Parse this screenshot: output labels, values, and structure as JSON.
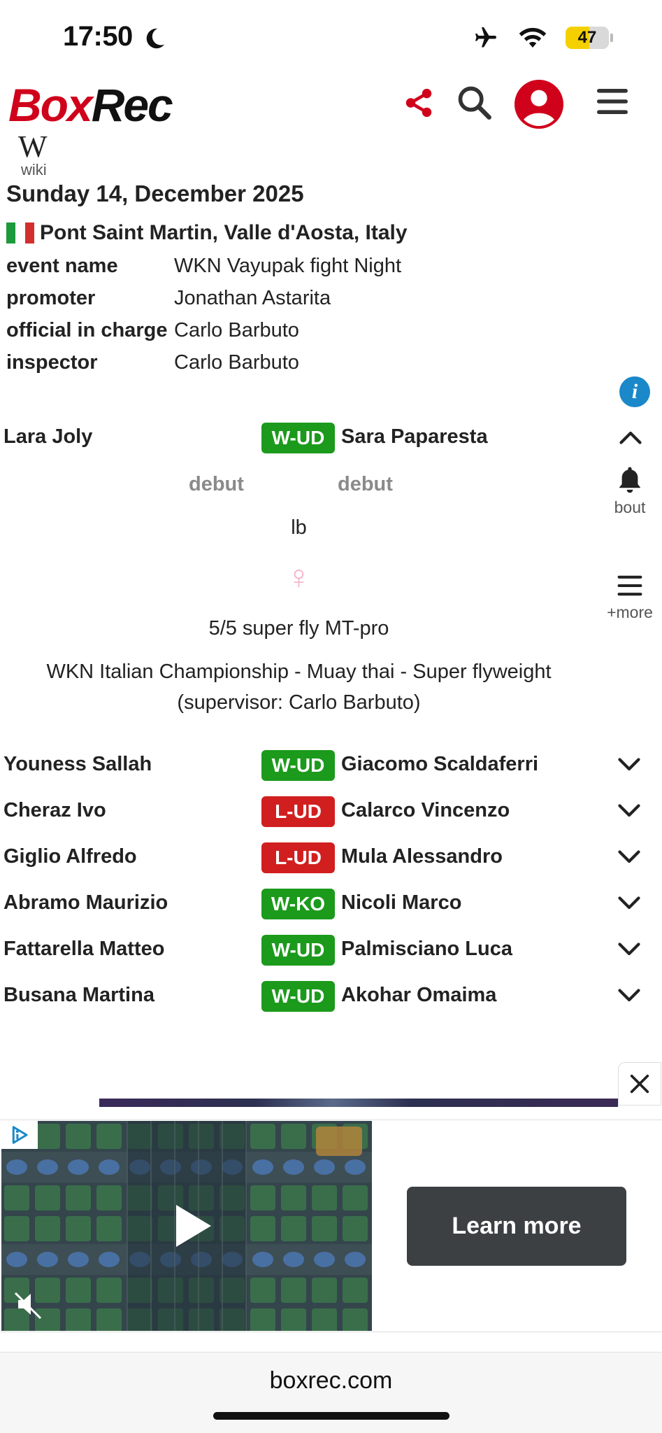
{
  "status_bar": {
    "time": "17:50",
    "battery": "47"
  },
  "header": {
    "logo_box": "Box",
    "logo_rec": "Rec",
    "wiki_symbol": "W",
    "wiki_label": "wiki"
  },
  "event": {
    "date": "Sunday 14, December 2025",
    "location": "Pont Saint Martin, Valle d'Aosta, Italy",
    "details": [
      {
        "label": "event name",
        "value": "WKN Vayupak fight Night"
      },
      {
        "label": "promoter",
        "value": "Jonathan Astarita"
      },
      {
        "label": "official in charge",
        "value": "Carlo Barbuto"
      },
      {
        "label": "inspector",
        "value": "Carlo Barbuto"
      }
    ]
  },
  "main_bout": {
    "fighter_a": "Lara Joly",
    "result": "W-UD",
    "fighter_b": "Sara Paparesta",
    "record_a": "debut",
    "record_b": "debut",
    "weight_unit": "lb",
    "gender_symbol": "♀",
    "rounds_and_class": "5/5 super fly  MT-pro",
    "title_line1": "WKN Italian Championship - Muay thai - Super flyweight",
    "title_line2": "(supervisor: Carlo Barbuto)"
  },
  "side_actions": {
    "bout_label": "bout",
    "more_label": "+more"
  },
  "bouts": [
    {
      "fighter_a": "Youness Sallah",
      "result": "W-UD",
      "outcome": "win",
      "fighter_b": "Giacomo Scaldaferri"
    },
    {
      "fighter_a": "Cheraz Ivo",
      "result": "L-UD",
      "outcome": "loss",
      "fighter_b": "Calarco Vincenzo"
    },
    {
      "fighter_a": "Giglio Alfredo",
      "result": "L-UD",
      "outcome": "loss",
      "fighter_b": "Mula Alessandro"
    },
    {
      "fighter_a": "Abramo Maurizio",
      "result": "W-KO",
      "outcome": "win",
      "fighter_b": "Nicoli Marco"
    },
    {
      "fighter_a": "Fattarella Matteo",
      "result": "W-UD",
      "outcome": "win",
      "fighter_b": "Palmisciano Luca"
    },
    {
      "fighter_a": "Busana Martina",
      "result": "W-UD",
      "outcome": "win",
      "fighter_b": "Akohar Omaima"
    }
  ],
  "ad": {
    "cta": "Learn more"
  },
  "browser": {
    "url": "boxrec.com"
  },
  "colors": {
    "brand_red": "#d0021b",
    "win_green": "#1b9a1b",
    "loss_red": "#d11f1f",
    "info_blue": "#1a88c9",
    "gender_pink": "#f4b6c8"
  }
}
